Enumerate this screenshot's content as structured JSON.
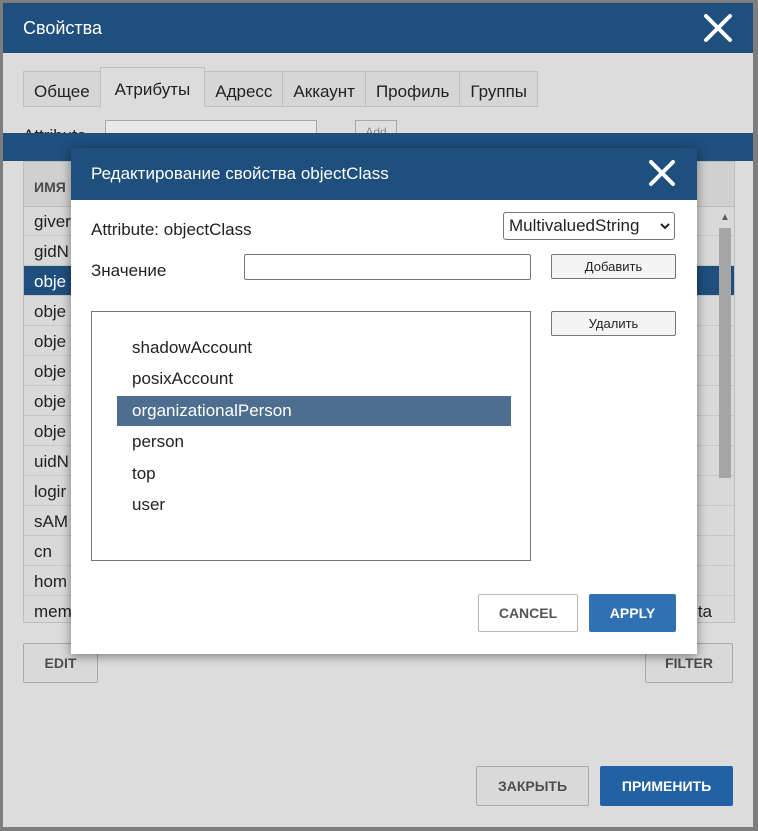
{
  "outer_dialog": {
    "title": "Свойства",
    "close_icon": "close-icon",
    "tabs": [
      {
        "label": "Общее"
      },
      {
        "label": "Атрибуты"
      },
      {
        "label": "Адресс"
      },
      {
        "label": "Аккаунт"
      },
      {
        "label": "Профиль"
      },
      {
        "label": "Группы"
      }
    ],
    "active_tab": "Атрибуты",
    "attribute_label": "Attribute",
    "attribute_value": "",
    "add_label": "Add",
    "grid": {
      "header_label": "ИМЯ",
      "rows": [
        "giver",
        "gidN",
        "obje",
        "obje",
        "obje",
        "obje",
        "obje",
        "obje",
        "uidN",
        "logir",
        "sAM",
        "cn",
        "hom",
        "mem"
      ],
      "selected_index": 2,
      "last_row_right_text": "ta"
    },
    "edit_label": "EDIT",
    "filter_label": "FILTER",
    "close_label": "ЗАКРЫТЬ",
    "apply_label": "ПРИМЕНИТЬ"
  },
  "modal": {
    "title": "Редактирование свойства objectClass",
    "close_icon": "close-icon",
    "attribute_text": "Attribute: objectClass",
    "type_select": "MultivaluedString",
    "value_label": "Значение",
    "value_input": "",
    "add_button": "Добавить",
    "delete_button": "Удалить",
    "values": [
      "shadowAccount",
      "posixAccount",
      "organizationalPerson",
      "person",
      "top",
      "user"
    ],
    "selected_value": "organizationalPerson",
    "cancel_label": "CANCEL",
    "apply_label": "APPLY"
  },
  "colors": {
    "header_blue": "#1e4f7d",
    "primary_blue": "#2261a3",
    "selection_gray_blue": "#4e6e8f"
  }
}
